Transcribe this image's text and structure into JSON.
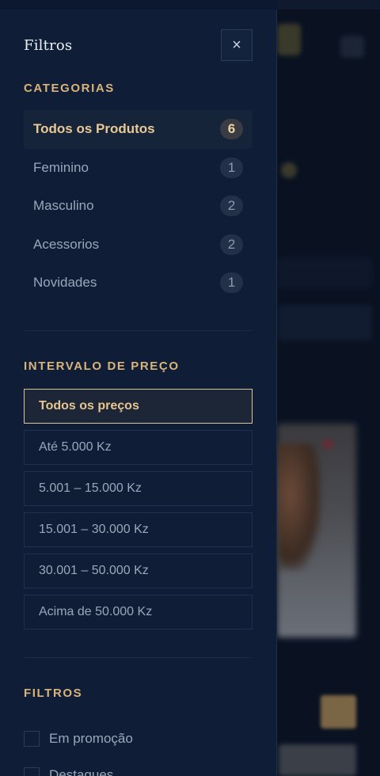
{
  "drawer": {
    "title": "Filtros",
    "close_icon": "×"
  },
  "categories": {
    "title": "CATEGORIAS",
    "items": [
      {
        "label": "Todos os Produtos",
        "count": "6",
        "active": true
      },
      {
        "label": "Feminino",
        "count": "1",
        "active": false
      },
      {
        "label": "Masculino",
        "count": "2",
        "active": false
      },
      {
        "label": "Acessorios",
        "count": "2",
        "active": false
      },
      {
        "label": "Novidades",
        "count": "1",
        "active": false
      }
    ]
  },
  "price": {
    "title": "INTERVALO DE PREÇO",
    "options": [
      {
        "label": "Todos os preços",
        "active": true
      },
      {
        "label": "Até 5.000 Kz",
        "active": false
      },
      {
        "label": "5.001 – 15.000 Kz",
        "active": false
      },
      {
        "label": "15.001 – 30.000 Kz",
        "active": false
      },
      {
        "label": "30.001 – 50.000 Kz",
        "active": false
      },
      {
        "label": "Acima de 50.000 Kz",
        "active": false
      }
    ]
  },
  "filters": {
    "title": "FILTROS",
    "options": [
      {
        "label": "Em promoção",
        "checked": false
      },
      {
        "label": "Destaques",
        "checked": false
      }
    ]
  },
  "colors": {
    "accent": "#d9b47a",
    "drawer_bg": "#0f1e36",
    "page_bg": "#0b1324"
  }
}
